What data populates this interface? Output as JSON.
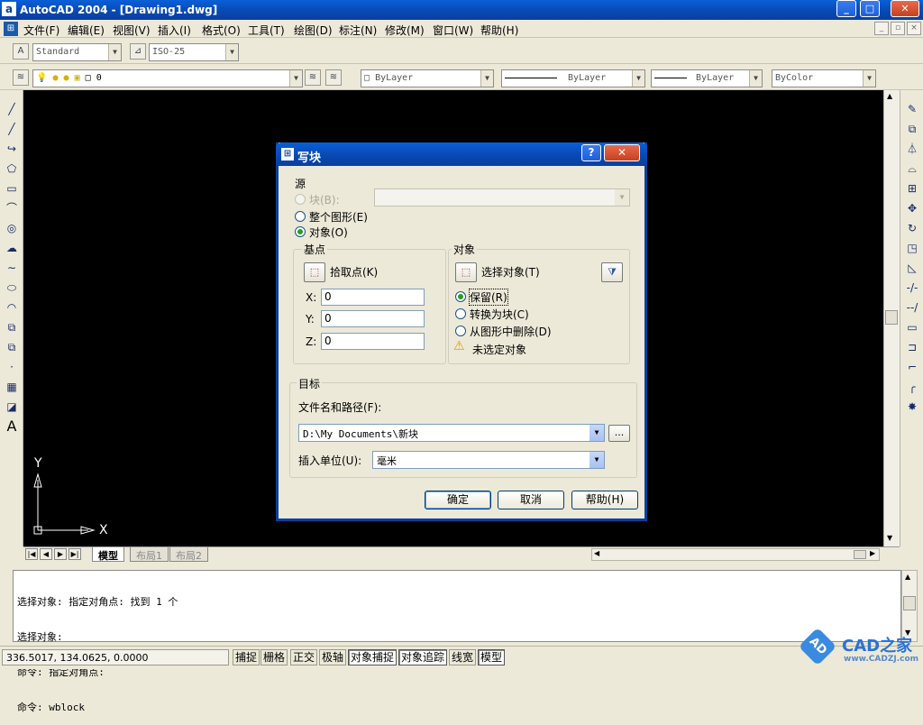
{
  "window": {
    "title": "AutoCAD 2004 - [Drawing1.dwg]",
    "app_icon": "a",
    "minimize": "_",
    "restore": "□",
    "close": "✕"
  },
  "menubar": {
    "items": [
      "文件(F)",
      "编辑(E)",
      "视图(V)",
      "插入(I)",
      "格式(O)",
      "工具(T)",
      "绘图(D)",
      "标注(N)",
      "修改(M)",
      "窗口(W)",
      "帮助(H)"
    ]
  },
  "styles_toolbar": {
    "text_style": "Standard",
    "dim_style": "ISO-25"
  },
  "layers_toolbar": {
    "layer": "0"
  },
  "properties_toolbar": {
    "color": "ByLayer",
    "linetype": "ByLayer",
    "lineweight": "ByLayer",
    "plotstyle": "ByColor"
  },
  "ucs": {
    "y_label": "Y",
    "x_label": "X"
  },
  "layout_tabs": [
    "模型",
    "布局1",
    "布局2"
  ],
  "command_lines": [
    "选择对象: 指定对角点: 找到 1 个",
    "选择对象:",
    "命令: 指定对角点:",
    "命令: wblock"
  ],
  "status": {
    "coords": "336.5017, 134.0625, 0.0000",
    "buttons": [
      {
        "label": "捕捉",
        "on": false
      },
      {
        "label": "栅格",
        "on": false
      },
      {
        "label": "正交",
        "on": false
      },
      {
        "label": "极轴",
        "on": false
      },
      {
        "label": "对象捕捉",
        "on": true
      },
      {
        "label": "对象追踪",
        "on": true
      },
      {
        "label": "线宽",
        "on": false
      },
      {
        "label": "模型",
        "on": true
      }
    ]
  },
  "watermark": {
    "brand": "CAD之家",
    "url": "www.CADZJ.com"
  },
  "dialog": {
    "title": "写块",
    "help_btn": "?",
    "close_btn": "✕",
    "source": {
      "label": "源",
      "block": "块(B):",
      "entire": "整个图形(E)",
      "objects": "对象(O)"
    },
    "base_point": {
      "label": "基点",
      "pick": "拾取点(K)",
      "x_label": "X:",
      "x": "0",
      "y_label": "Y:",
      "y": "0",
      "z_label": "Z:",
      "z": "0"
    },
    "objects": {
      "label": "对象",
      "select": "选择对象(T)",
      "retain": "保留(R)",
      "convert": "转换为块(C)",
      "delete": "从图形中删除(D)",
      "status": "未选定对象"
    },
    "destination": {
      "label": "目标",
      "path_label": "文件名和路径(F):",
      "path": "D:\\My Documents\\新块",
      "browse": "...",
      "units_label": "插入单位(U):",
      "units": "毫米"
    },
    "buttons": {
      "ok": "确定",
      "cancel": "取消",
      "help": "帮助(H)"
    }
  }
}
